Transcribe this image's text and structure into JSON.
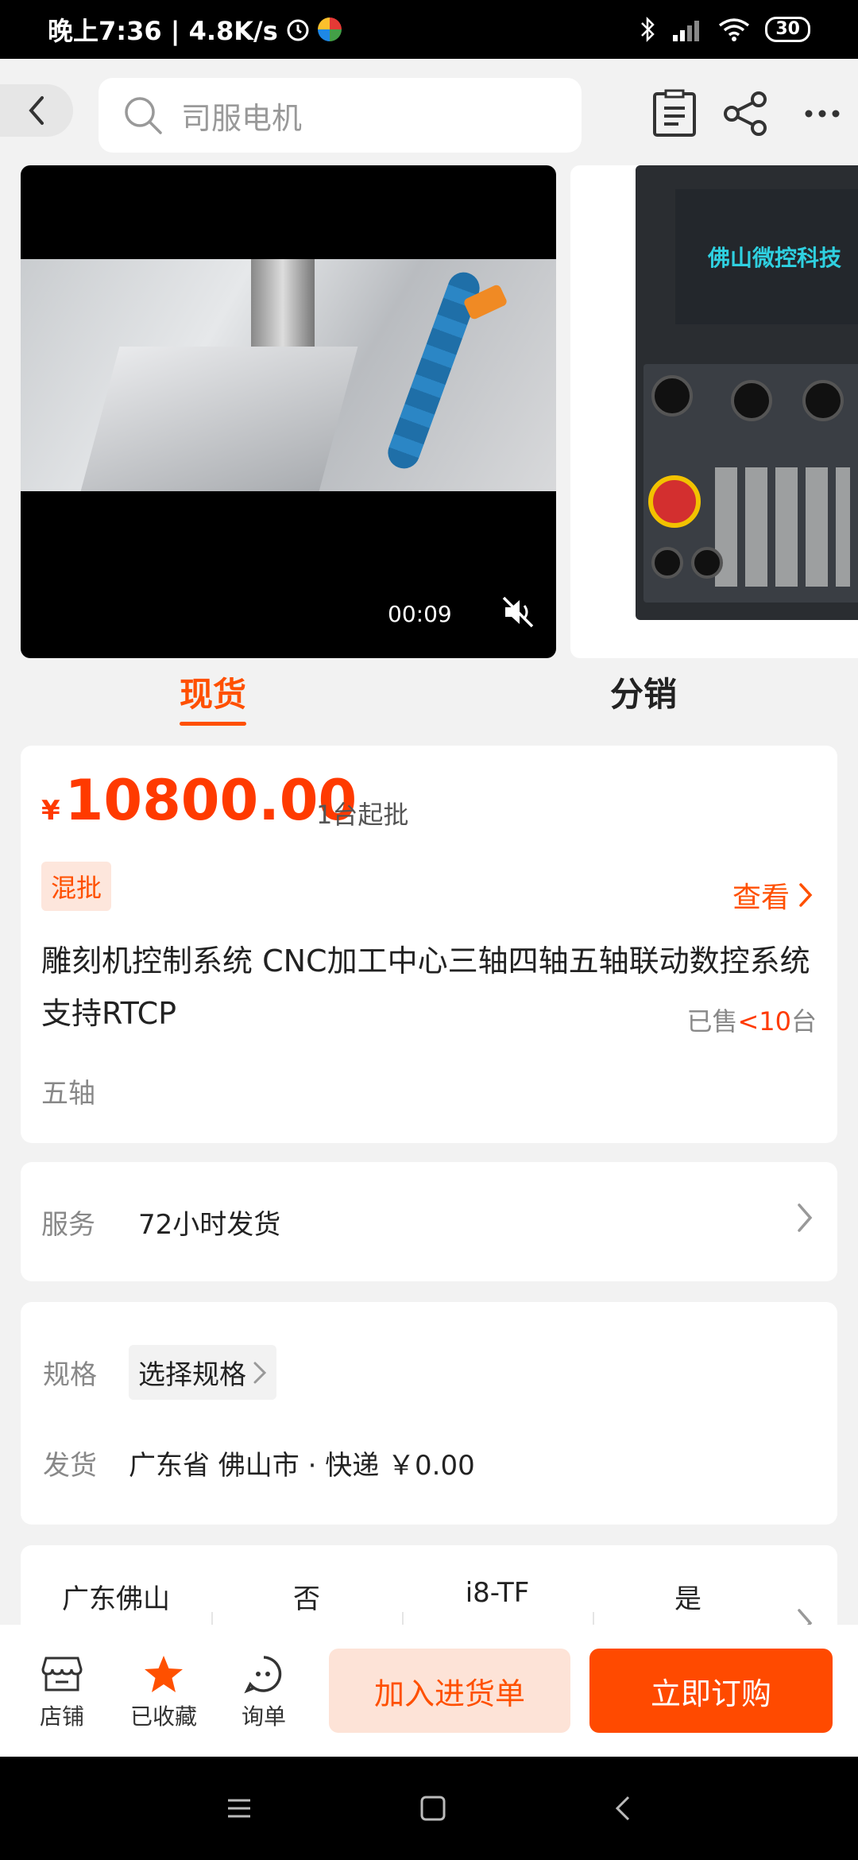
{
  "status_bar": {
    "time_speed": "晚上7:36 | 4.8K/s",
    "battery": "30"
  },
  "search": {
    "placeholder": "司服电机"
  },
  "video": {
    "time": "00:09",
    "panel_brand": "佛山微控科技"
  },
  "tabs": {
    "active": "现货",
    "other": "分销"
  },
  "product": {
    "currency": "¥",
    "price": "10800.00",
    "moq": "1台起批",
    "badge": "混批",
    "view_label": "查看",
    "title": "雕刻机控制系统 CNC加工中心三轴四轴五轴联动数控系统 支持RTCP",
    "sold_prefix": "已售",
    "sold_value": "<10",
    "sold_unit": "台",
    "variant": "五轴"
  },
  "service": {
    "label": "服务",
    "value": "72小时发货"
  },
  "spec": {
    "label": "规格",
    "select_label": "选择规格",
    "ship_label": "发货",
    "ship_value": "广东省 佛山市 · 快递 ￥0.00"
  },
  "attributes": [
    "广东佛山",
    "否",
    "i8-TF",
    "是"
  ],
  "bottom_bar": {
    "shop_label": "店铺",
    "fav_label": "已收藏",
    "inquiry_label": "询单",
    "cart_button": "加入进货单",
    "buy_button": "立即订购"
  },
  "colors": {
    "accent": "#ff5000",
    "price": "#ff3a00"
  }
}
